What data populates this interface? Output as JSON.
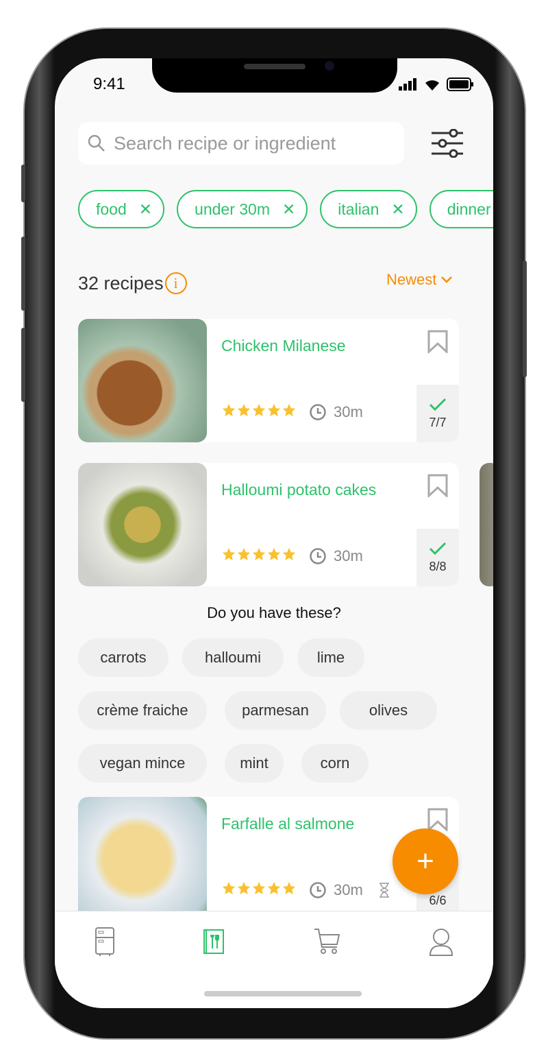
{
  "status_bar": {
    "time": "9:41"
  },
  "search": {
    "placeholder": "Search recipe or ingredient"
  },
  "filters": [
    {
      "label": "food"
    },
    {
      "label": "under 30m"
    },
    {
      "label": "italian"
    },
    {
      "label": "dinner"
    }
  ],
  "results": {
    "count_label": "32 recipes",
    "sort_label": "Newest"
  },
  "recipes": [
    {
      "title": "Chicken Milanese",
      "rating": 5,
      "time": "30m",
      "ingredients": "7/7"
    },
    {
      "title": "Halloumi potato cakes",
      "rating": 5,
      "time": "30m",
      "ingredients": "8/8"
    },
    {
      "title": "Farfalle al salmone",
      "rating": 5,
      "time": "30m",
      "ingredients": "6/6"
    }
  ],
  "suggestions": {
    "question": "Do you have these?",
    "items": [
      "carrots",
      "halloumi",
      "lime",
      "crème fraiche",
      "parmesan",
      "olives",
      "vegan mince",
      "mint",
      "corn"
    ]
  },
  "tabbar": {
    "items": [
      {
        "icon": "fridge-icon"
      },
      {
        "icon": "recipe-book-icon",
        "active": true
      },
      {
        "icon": "cart-icon"
      },
      {
        "icon": "profile-icon"
      }
    ]
  },
  "colors": {
    "accent": "#2dc26b",
    "orange": "#f78c00",
    "star": "#fbc02d"
  }
}
